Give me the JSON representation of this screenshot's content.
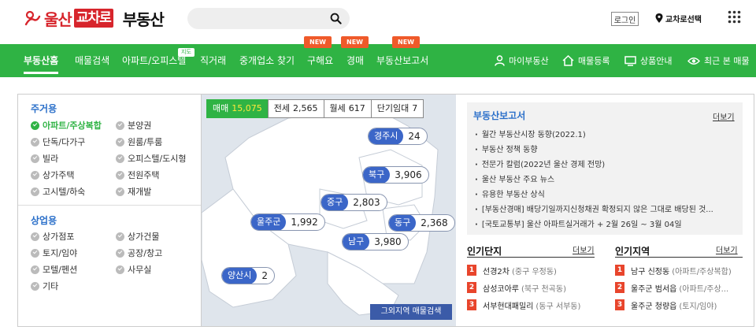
{
  "brand": {
    "name_red": "울산",
    "name_box": "교차로",
    "name_black": "부동산"
  },
  "search": {
    "placeholder": "",
    "value": ""
  },
  "header": {
    "login_label": "로그인",
    "region_label": "교차로선택"
  },
  "nav": {
    "items": [
      "부동산홈",
      "매물검색",
      "아파트/오피스텔",
      "직거래",
      "중개업소 찾기",
      "구해요",
      "경매",
      "부동산보고서"
    ],
    "map_badge": "지도",
    "new_badge": "NEW",
    "right_items": [
      "마이부동산",
      "매물등록",
      "상품안내",
      "최근 본 매물"
    ]
  },
  "categories": {
    "residential": {
      "title": "주거용",
      "items": [
        "아파트/주상복합",
        "분양권",
        "단독/다가구",
        "원룸/투룸",
        "빌라",
        "오피스텔/도시형",
        "상가주택",
        "전원주택",
        "고시텔/하숙",
        "재개발"
      ],
      "selected": "아파트/주상복합"
    },
    "commercial": {
      "title": "상업용",
      "items": [
        "상가점포",
        "상가건물",
        "토지/임야",
        "공장/창고",
        "모텔/펜션",
        "사무실",
        "기타"
      ]
    }
  },
  "map": {
    "tabs": [
      {
        "label": "매매",
        "count": "15,075"
      },
      {
        "label": "전세",
        "count": "2,565"
      },
      {
        "label": "월세",
        "count": "617"
      },
      {
        "label": "단기임대",
        "count": "7"
      }
    ],
    "regions": [
      {
        "name": "경주시",
        "count": "24"
      },
      {
        "name": "북구",
        "count": "3,906"
      },
      {
        "name": "중구",
        "count": "2,803"
      },
      {
        "name": "동구",
        "count": "2,368"
      },
      {
        "name": "울주군",
        "count": "1,992"
      },
      {
        "name": "남구",
        "count": "3,980"
      },
      {
        "name": "양산시",
        "count": "2"
      }
    ],
    "other_button": "그외지역 매물검색"
  },
  "report": {
    "title": "부동산보고서",
    "more": "더보기",
    "items": [
      "월간 부동산시장 동향(2022.1)",
      "부동산 정책 동향",
      "전문가 칼럼(2022년 울산 경제 전망)",
      "울산 부동산 주요 뉴스",
      "유용한 부동산 상식",
      "[부동산경매] 배당기일까지신청채권 확정되지 않은 그대로 배당된 것...",
      "[국토교통부] 울산 아파트실거래가 + 2월 26일 ~ 3월 04일"
    ]
  },
  "popular_complex": {
    "title": "인기단지",
    "more": "더보기",
    "items": [
      {
        "rank": "1",
        "name": "선경2차",
        "sub": "(중구 우정동)"
      },
      {
        "rank": "2",
        "name": "삼성코아루",
        "sub": "(북구 천곡동)"
      },
      {
        "rank": "3",
        "name": "서부현대패밀리",
        "sub": "(동구 서부동)"
      }
    ]
  },
  "popular_region": {
    "title": "인기지역",
    "more": "더보기",
    "items": [
      {
        "rank": "1",
        "name": "남구 신정동",
        "sub": "(아파트/주상복합)"
      },
      {
        "rank": "2",
        "name": "울주군 범서읍",
        "sub": "(아파트/주상..."
      },
      {
        "rank": "3",
        "name": "울주군 청량읍",
        "sub": "(토지/임야)"
      }
    ]
  },
  "colors": {
    "accent_green": "#2fb344",
    "brand_red": "#d7252c",
    "new_badge": "#ef5a2a",
    "region_blue": "#3b66c8",
    "rank_red": "#e8452c"
  }
}
